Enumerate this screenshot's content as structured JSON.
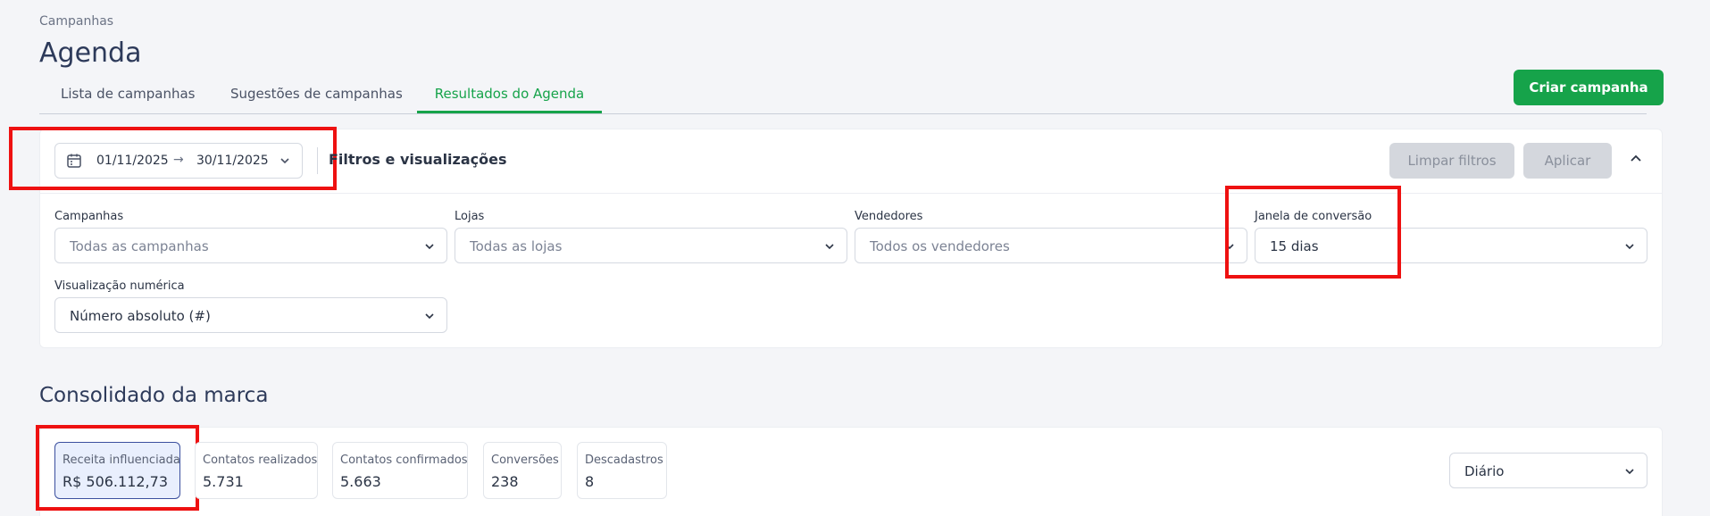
{
  "header": {
    "breadcrumb": "Campanhas",
    "title": "Agenda",
    "create_button": "Criar campanha"
  },
  "tabs": [
    {
      "label": "Lista de campanhas",
      "active": false
    },
    {
      "label": "Sugestões de campanhas",
      "active": false
    },
    {
      "label": "Resultados do Agenda",
      "active": true
    }
  ],
  "filters": {
    "date_start": "01/11/2025",
    "date_end": "30/11/2025",
    "title": "Filtros e visualizações",
    "clear_button": "Limpar filtros",
    "apply_button": "Aplicar",
    "campanhas": {
      "label": "Campanhas",
      "value": "Todas as campanhas"
    },
    "lojas": {
      "label": "Lojas",
      "value": "Todas as lojas"
    },
    "vendedores": {
      "label": "Vendedores",
      "value": "Todos os vendedores"
    },
    "janela": {
      "label": "Janela de conversão",
      "value": "15 dias"
    },
    "visualizacao": {
      "label": "Visualização numérica",
      "value": "Número absoluto (#)"
    }
  },
  "consolidado": {
    "title": "Consolidado da marca",
    "period": "Diário",
    "metrics": [
      {
        "label": "Receita influenciada",
        "value": "R$ 506.112,73",
        "active": true
      },
      {
        "label": "Contatos realizados",
        "value": "5.731",
        "active": false
      },
      {
        "label": "Contatos confirmados",
        "value": "5.663",
        "active": false
      },
      {
        "label": "Conversões",
        "value": "238",
        "active": false
      },
      {
        "label": "Descadastros",
        "value": "8",
        "active": false
      }
    ]
  },
  "colors": {
    "accent": "#16a34a",
    "title": "#2d3a5a",
    "highlight": "#ee1111",
    "active_metric_bg": "#e9effd"
  },
  "icons": [
    "calendar-icon",
    "arrow-right-icon",
    "chevron-down-icon",
    "chevron-up-icon"
  ]
}
